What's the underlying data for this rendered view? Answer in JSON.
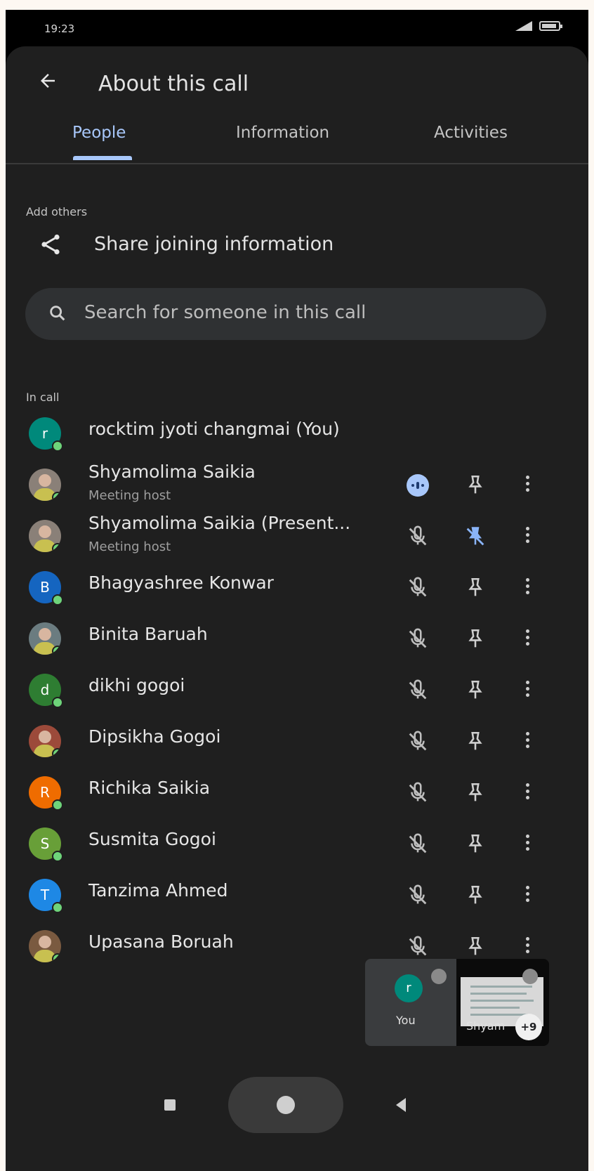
{
  "status_bar": {
    "time": "19:23"
  },
  "header": {
    "title": "About this call"
  },
  "tabs": [
    {
      "label": "People",
      "selected": true
    },
    {
      "label": "Information",
      "selected": false
    },
    {
      "label": "Activities",
      "selected": false
    }
  ],
  "add_others": {
    "section_label": "Add others",
    "share_label": "Share joining information"
  },
  "search": {
    "placeholder": "Search for someone in this call"
  },
  "in_call": {
    "section_label": "In call",
    "participants": [
      {
        "name": "rocktim jyoti changmai (You)",
        "subtitle": "",
        "avatar": "r",
        "avatar_color": "#00897b",
        "controls": false
      },
      {
        "name": "Shyamolima Saikia",
        "subtitle": "Meeting host",
        "avatar": "",
        "avatar_color": "#8a8078",
        "controls": true,
        "mic": "speaking",
        "pin": "on"
      },
      {
        "name": "Shyamolima Saikia (Present...",
        "subtitle": "Meeting host",
        "avatar": "",
        "avatar_color": "#8a8078",
        "controls": true,
        "mic": "muted",
        "pin": "pinned"
      },
      {
        "name": "Bhagyashree Konwar",
        "subtitle": "",
        "avatar": "B",
        "avatar_color": "#1565c0",
        "controls": true,
        "mic": "muted",
        "pin": "on"
      },
      {
        "name": "Binita Baruah",
        "subtitle": "",
        "avatar": "",
        "avatar_color": "#6b7c80",
        "controls": true,
        "mic": "muted",
        "pin": "on"
      },
      {
        "name": "dikhi gogoi",
        "subtitle": "",
        "avatar": "d",
        "avatar_color": "#2e7d32",
        "controls": true,
        "mic": "muted",
        "pin": "on"
      },
      {
        "name": "Dipsikha Gogoi",
        "subtitle": "",
        "avatar": "",
        "avatar_color": "#9c4a3a",
        "controls": true,
        "mic": "muted",
        "pin": "on"
      },
      {
        "name": "Richika Saikia",
        "subtitle": "",
        "avatar": "R",
        "avatar_color": "#ef6c00",
        "controls": true,
        "mic": "muted",
        "pin": "on"
      },
      {
        "name": "Susmita Gogoi",
        "subtitle": "",
        "avatar": "S",
        "avatar_color": "#689f38",
        "controls": true,
        "mic": "muted",
        "pin": "on"
      },
      {
        "name": "Tanzima Ahmed",
        "subtitle": "",
        "avatar": "T",
        "avatar_color": "#1e88e5",
        "controls": true,
        "mic": "muted",
        "pin": "on"
      },
      {
        "name": "Upasana Boruah",
        "subtitle": "",
        "avatar": "",
        "avatar_color": "#7a5a40",
        "controls": true,
        "mic": "muted",
        "pin": "on"
      }
    ]
  },
  "pip": {
    "self_avatar": "r",
    "self_label": "You",
    "other_label": "Shyam",
    "others_badge": "+9"
  }
}
